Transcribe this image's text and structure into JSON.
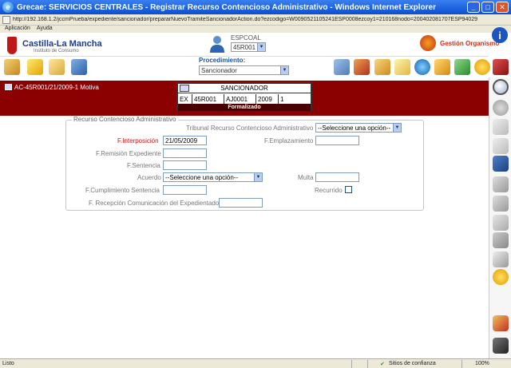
{
  "window": {
    "title": "Grecae: SERVICIOS CENTRALES - Registrar Recurso Contencioso Administrativo - Windows Internet Explorer",
    "url": "http://192.168.1.2/jccmPrueba/expediente/sancionador/prepararNuevoTramiteSancionadorAction.do?ezcodigo=W0090521105241ESP0008ezcoy1=210168nodo=200402081707ESP94029"
  },
  "menu": [
    "Aplicación",
    "Ayuda"
  ],
  "header": {
    "logo_title": "Castilla-La Mancha",
    "logo_subtitle": "Instituto de Consumo",
    "user_label": "ESPCOAL",
    "user_select": "45R001",
    "org_label": "Gestión Organismo"
  },
  "procedimiento": {
    "label": "Procedimiento:",
    "value": "Sancionador"
  },
  "expediente": {
    "title": "AC-45R001/21/2009-1 Motiva",
    "box_title": "SANCIONADOR",
    "cells": [
      "EX",
      "45R001",
      "AJ0001",
      "2009",
      "1"
    ],
    "status": "Formalizado"
  },
  "form": {
    "legend": "Recurso Contencioso Administrativo",
    "tribunal_label": "Tribunal Recurso Contencioso Administrativo",
    "tribunal_value": "--Seleccione una opción--",
    "interposicion_label": "F.Interposición",
    "interposicion_value": "21/05/2009",
    "emplazamiento_label": "F.Emplazamiento",
    "emplazamiento_value": "",
    "remision_label": "F.Remisión Expediente",
    "remision_value": "",
    "sentencia_label": "F.Sentencia",
    "sentencia_value": "",
    "acuerdo_label": "Acuerdo",
    "acuerdo_value": "--Seleccione una opción--",
    "multa_label": "Multa",
    "multa_value": "",
    "cumplimiento_label": "F.Cumplimiento Sentencia",
    "cumplimiento_value": "",
    "recurrido_label": "Recurrido",
    "recepcion_label": "F. Recepción Comunicación del Expedientado",
    "recepcion_value": ""
  },
  "status": {
    "left": "Listo",
    "zone": "Sitios de confianza",
    "zoom": "100%"
  },
  "colors": {
    "accent_band": "#8b0000",
    "required_label": "#d01010",
    "titlebar": "#0a4fd0"
  }
}
